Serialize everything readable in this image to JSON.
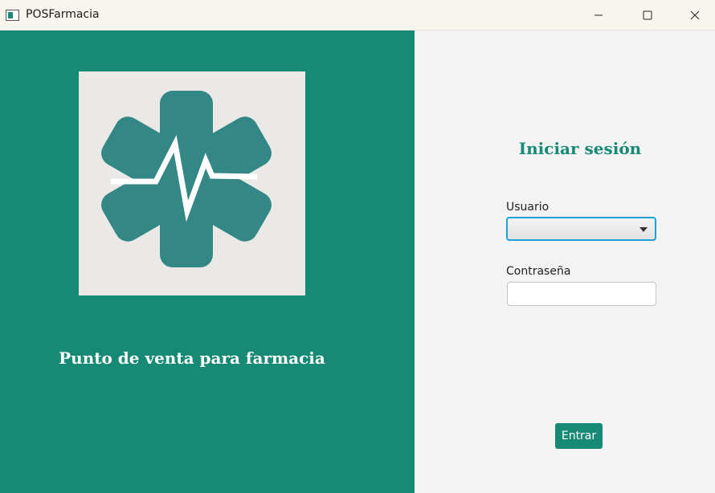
{
  "window": {
    "title": "POSFarmacia",
    "controls": [
      "minimize-icon",
      "maximize-icon",
      "close-icon"
    ]
  },
  "left_panel": {
    "logo_icon": "medical-star-heartbeat-icon",
    "tagline": "Punto de venta para farmacia"
  },
  "login": {
    "title": "Iniciar sesión",
    "user_label": "Usuario",
    "user_value": "",
    "password_label": "Contraseña",
    "password_value": "",
    "submit_label": "Entrar"
  },
  "colors": {
    "brand": "#168a74",
    "logo": "#338784",
    "logo_background": "#ebe9e7",
    "focus": "#1ea0d8"
  }
}
